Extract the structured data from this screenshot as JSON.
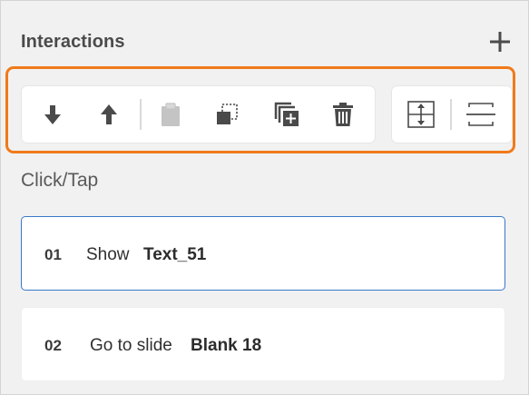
{
  "panel": {
    "title": "Interactions",
    "add_icon": "plus-icon"
  },
  "toolbar": {
    "highlight_color": "#f07a1a",
    "tools": [
      {
        "icon": "move-down-icon",
        "enabled": true
      },
      {
        "icon": "move-up-icon",
        "enabled": true
      },
      {
        "icon": "paste-icon",
        "enabled": false
      },
      {
        "icon": "copy-icon",
        "enabled": true
      },
      {
        "icon": "duplicate-icon",
        "enabled": true
      },
      {
        "icon": "delete-icon",
        "enabled": true
      },
      {
        "icon": "expand-icon",
        "enabled": true
      },
      {
        "icon": "collapse-icon",
        "enabled": true
      }
    ]
  },
  "section": {
    "trigger_label": "Click/Tap"
  },
  "interactions": [
    {
      "number": "01",
      "action": "Show",
      "target": "Text_51",
      "selected": true
    },
    {
      "number": "02",
      "action": "Go to slide",
      "target": "Blank 18",
      "selected": false
    }
  ],
  "colors": {
    "selected_border": "#3a78c9"
  }
}
